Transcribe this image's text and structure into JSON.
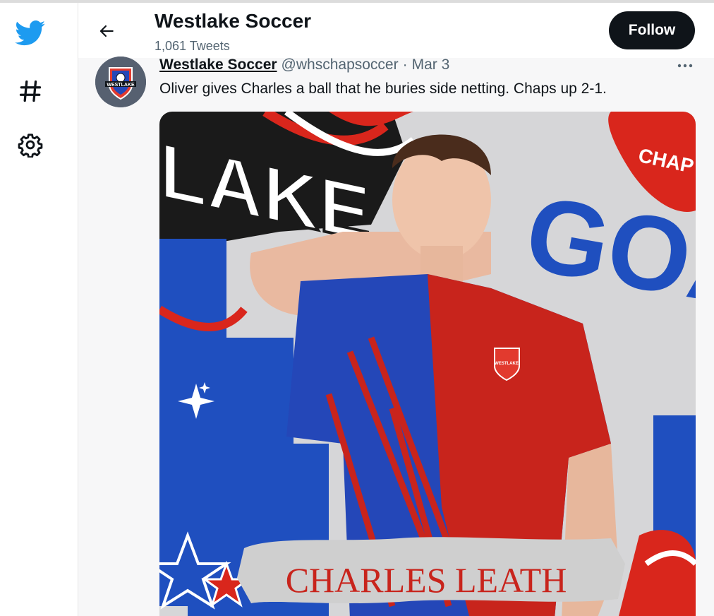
{
  "nav": {
    "icons": [
      "twitter-bird-icon",
      "hashtag-icon",
      "settings-gear-icon"
    ],
    "brand_color": "#1d9bf0"
  },
  "header": {
    "title": "Westlake Soccer",
    "subtitle": "1,061 Tweets",
    "follow_label": "Follow"
  },
  "tweet": {
    "display_name": "Westlake Soccer",
    "handle": "@whschapsoccer",
    "separator": "·",
    "date": "Mar 3",
    "text": "Oliver gives Charles a ball that he buries side netting. Chaps up 2-1.",
    "avatar_text": "WESTLAKE",
    "media": {
      "banner_name": "CHARLES LEATH",
      "bg_text_goal": "GOAL",
      "bg_text_lake": "LAKE",
      "bg_text_chaps": "CHAP",
      "crest_text": "WESTLAKE"
    }
  },
  "colors": {
    "blue": "#1f4fbf",
    "red": "#d9261c",
    "dark": "#0f1419",
    "muted": "#536471"
  }
}
